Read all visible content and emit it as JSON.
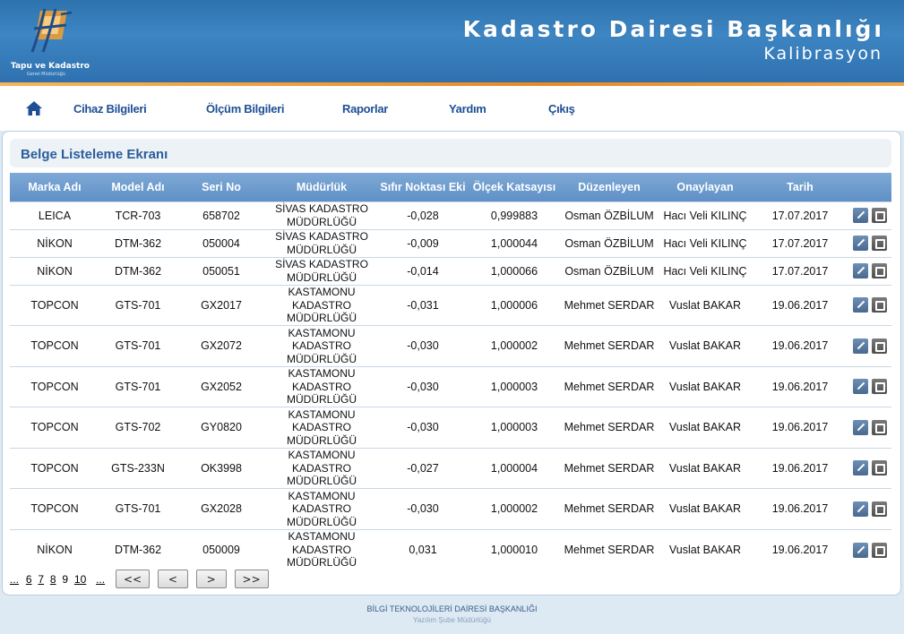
{
  "header": {
    "logo_text": "Tapu ve Kadastro",
    "logo_sub": "Genel Müdürlüğü",
    "title": "Kadastro Dairesi Başkanlığı",
    "subtitle": "Kalibrasyon"
  },
  "nav": {
    "home_icon": "home-icon",
    "items": [
      "Cihaz Bilgileri",
      "Ölçüm Bilgileri",
      "Raporlar",
      "Yardım",
      "Çıkış"
    ]
  },
  "panel": {
    "title": "Belge Listeleme Ekranı"
  },
  "table": {
    "columns": [
      "Marka Adı",
      "Model Adı",
      "Seri No",
      "Müdürlük",
      "Sıfır Noktası Eki",
      "Ölçek Katsayısı",
      "Düzenleyen",
      "Onaylayan",
      "Tarih"
    ],
    "rows": [
      [
        "LEICA",
        "TCR-703",
        "658702",
        "SİVAS KADASTRO MÜDÜRLÜĞÜ",
        "-0,028",
        "0,999883",
        "Osman ÖZBİLUM",
        "Hacı Veli KILINÇ",
        "17.07.2017"
      ],
      [
        "NİKON",
        "DTM-362",
        "050004",
        "SİVAS KADASTRO MÜDÜRLÜĞÜ",
        "-0,009",
        "1,000044",
        "Osman ÖZBİLUM",
        "Hacı Veli KILINÇ",
        "17.07.2017"
      ],
      [
        "NİKON",
        "DTM-362",
        "050051",
        "SİVAS KADASTRO MÜDÜRLÜĞÜ",
        "-0,014",
        "1,000066",
        "Osman ÖZBİLUM",
        "Hacı Veli KILINÇ",
        "17.07.2017"
      ],
      [
        "TOPCON",
        "GTS-701",
        "GX2017",
        "KASTAMONU KADASTRO MÜDÜRLÜĞÜ",
        "-0,031",
        "1,000006",
        "Mehmet SERDAR",
        "Vuslat BAKAR",
        "19.06.2017"
      ],
      [
        "TOPCON",
        "GTS-701",
        "GX2072",
        "KASTAMONU KADASTRO MÜDÜRLÜĞÜ",
        "-0,030",
        "1,000002",
        "Mehmet SERDAR",
        "Vuslat BAKAR",
        "19.06.2017"
      ],
      [
        "TOPCON",
        "GTS-701",
        "GX2052",
        "KASTAMONU KADASTRO MÜDÜRLÜĞÜ",
        "-0,030",
        "1,000003",
        "Mehmet SERDAR",
        "Vuslat BAKAR",
        "19.06.2017"
      ],
      [
        "TOPCON",
        "GTS-702",
        "GY0820",
        "KASTAMONU KADASTRO MÜDÜRLÜĞÜ",
        "-0,030",
        "1,000003",
        "Mehmet SERDAR",
        "Vuslat BAKAR",
        "19.06.2017"
      ],
      [
        "TOPCON",
        "GTS-233N",
        "OK3998",
        "KASTAMONU KADASTRO MÜDÜRLÜĞÜ",
        "-0,027",
        "1,000004",
        "Mehmet SERDAR",
        "Vuslat BAKAR",
        "19.06.2017"
      ],
      [
        "TOPCON",
        "GTS-701",
        "GX2028",
        "KASTAMONU KADASTRO MÜDÜRLÜĞÜ",
        "-0,030",
        "1,000002",
        "Mehmet SERDAR",
        "Vuslat BAKAR",
        "19.06.2017"
      ],
      [
        "NİKON",
        "DTM-362",
        "050009",
        "KASTAMONU KADASTRO MÜDÜRLÜĞÜ",
        "0,031",
        "1,000010",
        "Mehmet SERDAR",
        "Vuslat BAKAR",
        "19.06.2017"
      ]
    ],
    "row_actions": [
      "edit-icon",
      "pdf-icon"
    ]
  },
  "pager": {
    "prev_ellipsis": "...",
    "pages": [
      "6",
      "7",
      "8",
      "9",
      "10"
    ],
    "current_page": "9",
    "next_ellipsis": "...",
    "first_label": "<<",
    "prev_label": "<",
    "next_label": ">",
    "last_label": ">>"
  },
  "footer": {
    "line1": "BİLGİ TEKNOLOJİLERİ DAİRESİ BAŞKANLIĞI",
    "line2": "Yazılım Şube Müdürlüğü"
  },
  "colors": {
    "header_blue": "#2d72ae",
    "accent_orange": "#e98a24",
    "nav_text": "#1d4f95",
    "table_header": "#6b99cc"
  }
}
